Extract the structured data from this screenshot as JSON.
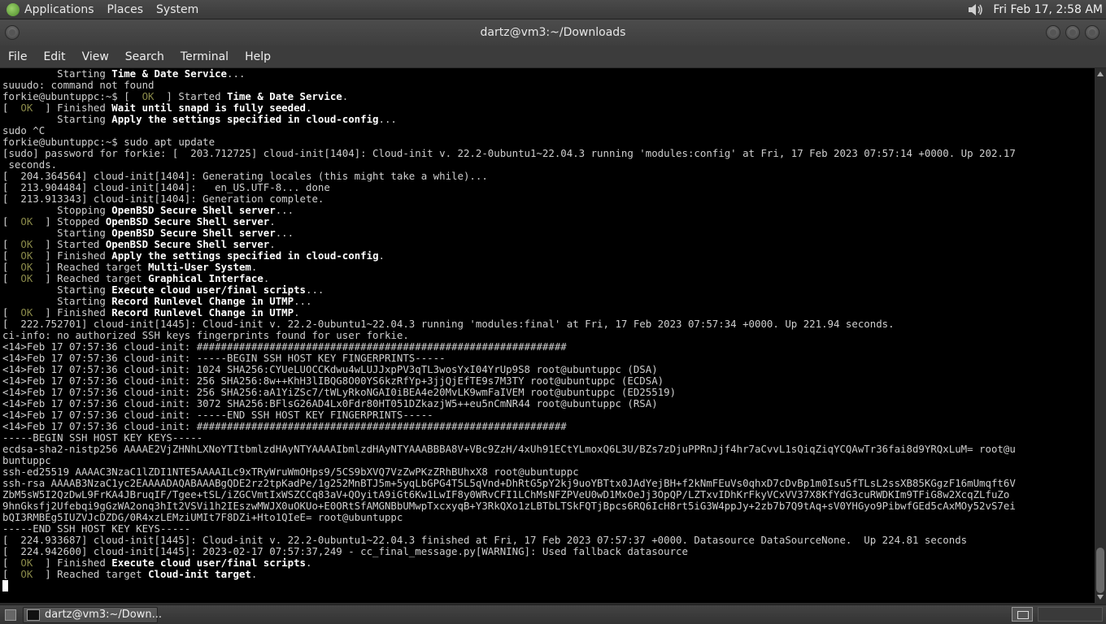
{
  "top_panel": {
    "menus": [
      "Applications",
      "Places",
      "System"
    ],
    "clock": "Fri Feb 17,  2:58 AM"
  },
  "window": {
    "title": "dartz@vm3:~/Downloads"
  },
  "menubar": [
    "File",
    "Edit",
    "View",
    "Search",
    "Terminal",
    "Help"
  ],
  "terminal_lines": [
    "         Starting <b>Time & Date Service</b>...",
    "suuudo: command not found",
    "forkie@ubuntuppc:~$ [  <ok>OK</ok>  ] Started <b>Time & Date Service</b>.",
    "[  <ok>OK</ok>  ] Finished <b>Wait until snapd is fully seeded</b>.",
    "         Starting <b>Apply the settings specified in cloud-config</b>...",
    "sudo ^C",
    "forkie@ubuntuppc:~$ sudo apt update",
    "[sudo] password for forkie: [  203.712725] cloud-init[1404]: Cloud-init v. 22.2-0ubuntu1~22.04.3 running 'modules:config' at Fri, 17 Feb 2023 07:57:14 +0000. Up 202.17",
    " seconds.",
    "[  204.364564] cloud-init[1404]: Generating locales (this might take a while)...",
    "[  213.904484] cloud-init[1404]:   en_US.UTF-8... done",
    "[  213.913343] cloud-init[1404]: Generation complete.",
    "         Stopping <b>OpenBSD Secure Shell server</b>...",
    "[  <ok>OK</ok>  ] Stopped <b>OpenBSD Secure Shell server</b>.",
    "         Starting <b>OpenBSD Secure Shell server</b>...",
    "[  <ok>OK</ok>  ] Started <b>OpenBSD Secure Shell server</b>.",
    "[  <ok>OK</ok>  ] Finished <b>Apply the settings specified in cloud-config</b>.",
    "[  <ok>OK</ok>  ] Reached target <b>Multi-User System</b>.",
    "[  <ok>OK</ok>  ] Reached target <b>Graphical Interface</b>.",
    "         Starting <b>Execute cloud user/final scripts</b>...",
    "         Starting <b>Record Runlevel Change in UTMP</b>...",
    "[  <ok>OK</ok>  ] Finished <b>Record Runlevel Change in UTMP</b>.",
    "[  222.752701] cloud-init[1445]: Cloud-init v. 22.2-0ubuntu1~22.04.3 running 'modules:final' at Fri, 17 Feb 2023 07:57:34 +0000. Up 221.94 seconds.",
    "ci-info: no authorized SSH keys fingerprints found for user forkie.",
    "<14>Feb 17 07:57:36 cloud-init: #############################################################",
    "<14>Feb 17 07:57:36 cloud-init: -----BEGIN SSH HOST KEY FINGERPRINTS-----",
    "<14>Feb 17 07:57:36 cloud-init: 1024 SHA256:CYUeLUOCCKdwu4wLUJJxpPV3qTL3wosYxI04YrUp9S8 root@ubuntuppc (DSA)",
    "<14>Feb 17 07:57:36 cloud-init: 256 SHA256:8w++KhH3lIBQG8O00YS6kzRfYp+3jjQjEfTE9s7M3TY root@ubuntuppc (ECDSA)",
    "<14>Feb 17 07:57:36 cloud-init: 256 SHA256:aA1YiZSc7/tWLyRkoNGAI0iBEA4e20MvLK9wmFaIVEM root@ubuntuppc (ED25519)",
    "<14>Feb 17 07:57:36 cloud-init: 3072 SHA256:BFlsG26AD4Lx0Fdr80HT051DZkazjW5++eu5nCmNR44 root@ubuntuppc (RSA)",
    "<14>Feb 17 07:57:36 cloud-init: -----END SSH HOST KEY FINGERPRINTS-----",
    "<14>Feb 17 07:57:36 cloud-init: #############################################################",
    "-----BEGIN SSH HOST KEY KEYS-----",
    "ecdsa-sha2-nistp256 AAAAE2VjZHNhLXNoYTItbmlzdHAyNTYAAAAIbmlzdHAyNTYAAABBBA8V+VBc9ZzH/4xUh91ECtYLmoxQ6L3U/BZs7zDjuPPRnJjf4hr7aCvvL1sQiqZiqYCQAwTr36fai8d9YRQxLuM= root@u",
    "buntuppc",
    "ssh-ed25519 AAAAC3NzaC1lZDI1NTE5AAAAILc9xTRyWruWmOHps9/5CS9bXVQ7VzZwPKzZRhBUhxX8 root@ubuntuppc",
    "ssh-rsa AAAAB3NzaC1yc2EAAAADAQABAAABgQDE2rz2tpKadPe/1g252MnBTJ5m+5yqLbGPG4T5L5qVnd+DhRtG5pY2kj9uoYBTtx0JAdYejBH+f2kNmFEuVs0qhxD7cDvBp1m0Isu5fTLsL2ssXB85KGgzF16mUmqft6V",
    "ZbM5sW5I2QzDwL9FrKA4JBruqIF/Tgee+tSL/iZGCVmtIxWSZCCq83aV+QOyitA9iGt6Kw1LwIF8y0WRvCFI1LChMsNFZPVeU0wD1MxOeJj3OpQP/LZTxvIDhKrFkyVCxVV37X8KfYdG3cuRWDKIm9TFiG8w2XcqZLfuZo",
    "9hnGksfj2Ufebqi9gGzWA2onq3hIt2VSVi1h2IEszwMWJX0uOKUo+E0ORtSfAMGNBbUMwpTxcxyqB+Y3RkQXo1zLBTbLTSkFQTjBpcs6RQ6IcH8rt5iG3W4ppJy+2zb7b7Q9tAq+sV0YHGyo9PibwfGEd5cAxMOy52vS7ei",
    "bQI3RMBEg5IUZVJcDZDG/0R4xzLEMziUMIt7F8DZi+Hto1QIeE= root@ubuntuppc",
    "-----END SSH HOST KEY KEYS-----",
    "[  224.933687] cloud-init[1445]: Cloud-init v. 22.2-0ubuntu1~22.04.3 finished at Fri, 17 Feb 2023 07:57:37 +0000. Datasource DataSourceNone.  Up 224.81 seconds",
    "[  224.942600] cloud-init[1445]: 2023-02-17 07:57:37,249 - cc_final_message.py[WARNING]: Used fallback datasource",
    "[  <ok>OK</ok>  ] Finished <b>Execute cloud user/final scripts</b>.",
    "[  <ok>OK</ok>  ] Reached target <b>Cloud-init target</b>.",
    ""
  ],
  "taskbar": {
    "item_label": "dartz@vm3:~/Down..."
  }
}
